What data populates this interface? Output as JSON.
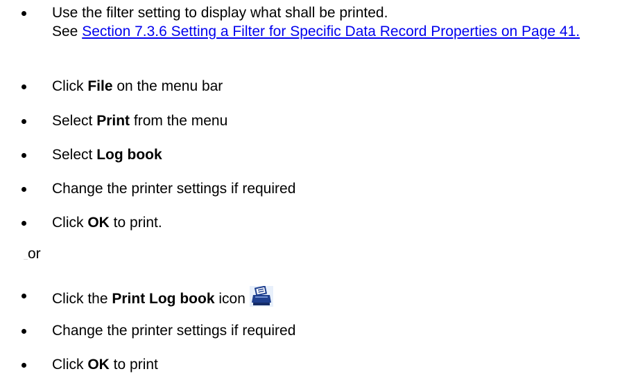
{
  "steps_a": [
    {
      "line1": "Use the filter setting to display what shall be printed.",
      "see_prefix": "See ",
      "link_text": "Section 7.3.6 Setting a Filter for Specific Data Record Properties on Page 41."
    },
    {
      "pre": "Click ",
      "bold": "File",
      "post": " on the menu bar"
    },
    {
      "pre": "Select ",
      "bold": "Print",
      "post": " from the menu"
    },
    {
      "pre": "Select ",
      "bold": "Log book",
      "post": ""
    },
    {
      "text": "Change the printer settings if required"
    },
    {
      "pre": "Click ",
      "bold": "OK",
      "post": " to print."
    }
  ],
  "or_text": "or",
  "steps_b": [
    {
      "pre": "Click the ",
      "bold": "Print Log book",
      "post": " icon",
      "icon": "printer-icon"
    },
    {
      "text": "Change the printer settings if required"
    },
    {
      "pre": "Click ",
      "bold": "OK",
      "post": " to print"
    }
  ],
  "colors": {
    "link": "#0000ee",
    "icon_body": "#1e3f8f",
    "icon_bg": "#e8f0fb"
  }
}
